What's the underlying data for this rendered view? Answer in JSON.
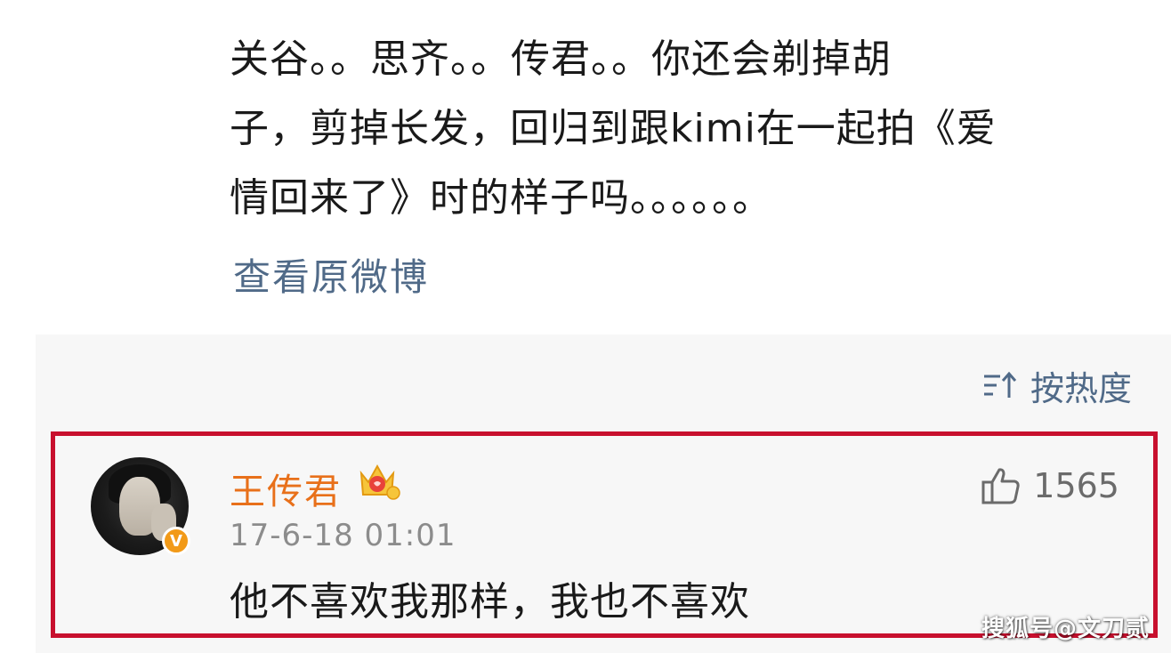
{
  "post": {
    "lines": [
      "关谷。。思齐。。传君。。你还会剃掉胡",
      "子，剪掉长发，回归到跟kimi在一起拍《爱",
      "情回来了》时的样子吗。。。。。。"
    ],
    "view_original": "查看原微博"
  },
  "comments": {
    "sort_label": "按热度",
    "sort_icon": "sort-icon",
    "comment": {
      "username": "王传君",
      "username_color": "#e8701a",
      "timestamp": "17-6-18 01:01",
      "text": "他不喜欢我那样，我也不喜欢",
      "like_count": "1565",
      "verified_badge": "V",
      "highlight_color": "#c8102e"
    }
  },
  "watermark": "搜狐号@文刀贰"
}
